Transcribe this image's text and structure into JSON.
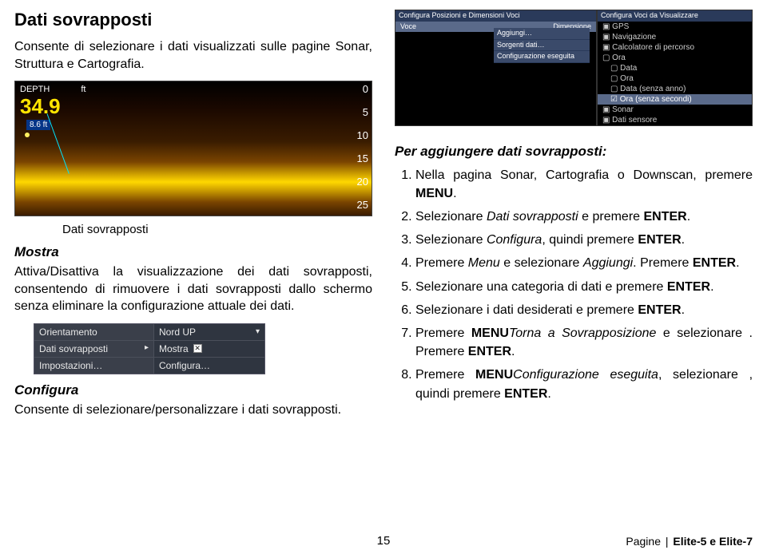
{
  "left": {
    "title": "Dati sovrapposti",
    "intro": "Consente di selezionare i dati visualizzati sulle pagine Sonar, Struttura e Cartografia.",
    "sonar": {
      "depth_label": "DEPTH",
      "depth_unit_header": "ft",
      "depth_value": "34.9",
      "small_depth": "8.6 ft",
      "scale": [
        "0",
        "5",
        "10",
        "15",
        "20",
        "25"
      ],
      "overlay_label": "Dati sovrapposti"
    },
    "mostra_heading": "Mostra",
    "mostra_para": "Attiva/Disattiva la visualizzazione dei dati sovrapposti, consentendo di rimuovere i dati sovrapposti dallo schermo senza eliminare la configurazione attuale dei dati.",
    "menu": {
      "row1_l": "Orientamento",
      "row1_r": "Nord UP",
      "row2_l": "Dati sovrapposti",
      "row2_r": "Mostra",
      "row3_l": "Impostazioni…",
      "row3_r": "Configura…"
    },
    "configura_heading": "Configura",
    "configura_para": "Consente di selezionare/personalizzare i dati sovrapposti."
  },
  "right": {
    "config_left": {
      "title": "Configura Posizioni e Dimensioni Voci",
      "col1": "Voce",
      "col2": "Dimensione",
      "actions": [
        "Aggiungi…",
        "Sorgenti dati…",
        "Configurazione eseguita"
      ]
    },
    "config_right": {
      "title": "Configura Voci da Visualizzare",
      "tree": [
        {
          "text": "▣ GPS",
          "cls": ""
        },
        {
          "text": "▣ Navigazione",
          "cls": ""
        },
        {
          "text": "▣ Calcolatore di percorso",
          "cls": ""
        },
        {
          "text": "▢ Ora",
          "cls": ""
        },
        {
          "text": "▢ Data",
          "cls": "tree-indent1"
        },
        {
          "text": "▢ Ora",
          "cls": "tree-indent1"
        },
        {
          "text": "▢ Data (senza anno)",
          "cls": "tree-indent1"
        },
        {
          "text": "☑ Ora (senza secondi)",
          "cls": "tree-indent1 highlight"
        },
        {
          "text": "▣ Sonar",
          "cls": ""
        },
        {
          "text": "▣ Dati sensore",
          "cls": ""
        }
      ]
    },
    "per_heading": "Per aggiungere dati sovrapposti:",
    "steps": [
      {
        "pre": "Nella pagina Sonar, Cartografia o Downscan, premere ",
        "bold": "MENU",
        "post": "."
      },
      {
        "pre": "Selezionare ",
        "ital": "Dati sovrapposti",
        "mid": " e premere ",
        "bold": "ENTER",
        "post": "."
      },
      {
        "pre": "Selezionare ",
        "ital": "Configura",
        "mid": ", quindi premere ",
        "bold": "ENTER",
        "post": "."
      },
      {
        "pre": "Premere ",
        "ital": "Menu",
        "mid": " e selezionare ",
        "ital2": "Aggiungi",
        "mid2": ". Premere ",
        "bold": "ENTER",
        "post": "."
      },
      {
        "pre": "Selezionare una categoria di dati e premere ",
        "bold": "ENTER",
        "post": "."
      },
      {
        "pre": "Selezionare i dati desiderati e premere ",
        "bold": "ENTER",
        "post": "."
      },
      {
        "pre": "Premere ",
        "bold1": "MENU",
        "mid": " e selezionare ",
        "ital": "Torna a Sovrapposizione",
        "mid2": ". Premere ",
        "bold": "ENTER",
        "post": "."
      },
      {
        "pre": "Premere ",
        "bold1": "MENU",
        "mid": ", selezionare ",
        "ital": "Configurazione eseguita",
        "mid2": ", quindi premere ",
        "bold": "ENTER",
        "post": "."
      }
    ]
  },
  "footer": {
    "pagenum": "15",
    "section": "Pagine",
    "product": "Elite-5 e Elite-7"
  }
}
